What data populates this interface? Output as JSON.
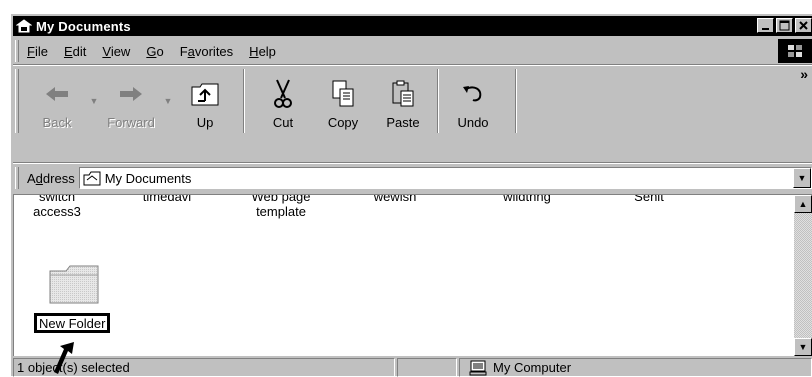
{
  "window": {
    "title": "My Documents"
  },
  "menu": {
    "items": [
      {
        "pre": "",
        "key": "F",
        "post": "ile"
      },
      {
        "pre": "",
        "key": "E",
        "post": "dit"
      },
      {
        "pre": "",
        "key": "V",
        "post": "iew"
      },
      {
        "pre": "",
        "key": "G",
        "post": "o"
      },
      {
        "pre": "F",
        "key": "a",
        "post": "vorites"
      },
      {
        "pre": "",
        "key": "H",
        "post": "elp"
      }
    ]
  },
  "toolbar": {
    "back": "Back",
    "forward": "Forward",
    "up": "Up",
    "cut": "Cut",
    "copy": "Copy",
    "paste": "Paste",
    "undo": "Undo",
    "more": "»"
  },
  "address": {
    "label_pre": "A",
    "label_key": "d",
    "label_post": "dress",
    "value": "My Documents"
  },
  "files": [
    {
      "line1": "switch",
      "line2": "access3"
    },
    {
      "line1": "timedavi",
      "line2": ""
    },
    {
      "line1": "Web page",
      "line2": "template"
    },
    {
      "line1": "wewish",
      "line2": ""
    },
    {
      "line1": "wildthng",
      "line2": ""
    },
    {
      "line1": "Senit",
      "line2": ""
    }
  ],
  "new_folder": {
    "name": "New Folder"
  },
  "status": {
    "selection": "1 object(s) selected",
    "zone": "My Computer"
  },
  "icons": [
    "window-folder-icon",
    "minimize-icon",
    "maximize-icon",
    "close-icon",
    "windows-logo-icon",
    "back-arrow-icon",
    "forward-arrow-icon",
    "up-folder-icon",
    "scissors-icon",
    "copy-icon",
    "paste-icon",
    "undo-icon",
    "address-folder-icon",
    "folder-icon",
    "my-computer-icon",
    "mouse-pointer-icon"
  ]
}
